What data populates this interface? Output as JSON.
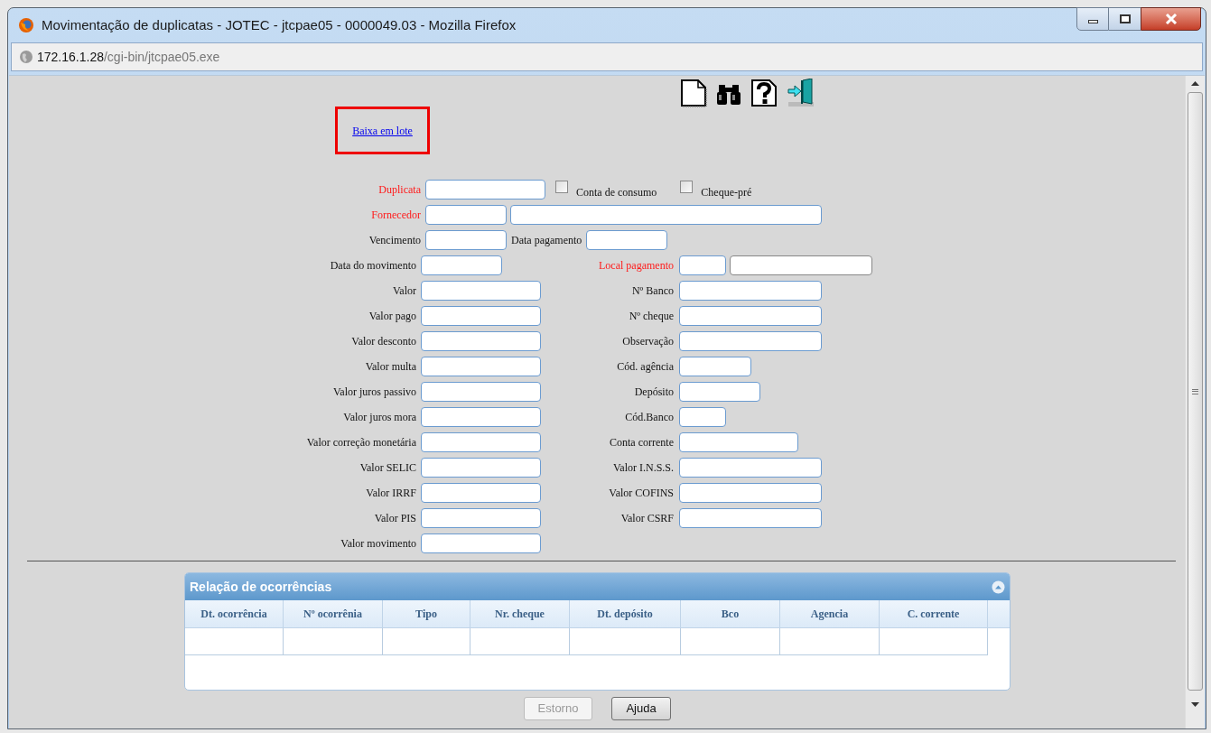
{
  "window": {
    "title": "Movimentação de duplicatas - JOTEC - jtcpae05 - 0000049.03 - Mozilla Firefox"
  },
  "address_bar": {
    "host": "172.16.1.28",
    "path": "/cgi-bin/jtcpae05.exe"
  },
  "link": {
    "text": "Baixa em lote",
    "highlighted": true
  },
  "form": {
    "duplicata": {
      "label": "Duplicata",
      "required": true
    },
    "checkboxes": [
      {
        "label": "Conta de consumo",
        "checked": false
      },
      {
        "label": "Cheque-pré",
        "checked": false
      }
    ],
    "fornecedor": {
      "label": "Fornecedor",
      "required": true
    },
    "vencimento": {
      "label": "Vencimento",
      "required": false
    },
    "data_pagamento": {
      "label": "Data pagamento",
      "required": false
    },
    "left_fields": [
      {
        "label": "Data do movimento",
        "required": false
      },
      {
        "label": "Valor",
        "required": false
      },
      {
        "label": "Valor pago",
        "required": false
      },
      {
        "label": "Valor desconto",
        "required": false
      },
      {
        "label": "Valor multa",
        "required": false
      },
      {
        "label": "Valor juros passivo",
        "required": false
      },
      {
        "label": "Valor juros mora",
        "required": false
      },
      {
        "label": "Valor correção monetária",
        "required": false
      },
      {
        "label": "Valor SELIC",
        "required": false
      },
      {
        "label": "Valor IRRF",
        "required": false
      },
      {
        "label": "Valor PIS",
        "required": false
      },
      {
        "label": "Valor movimento",
        "required": false
      }
    ],
    "right_fields": [
      {
        "label": "Local pagamento",
        "required": true
      },
      {
        "label": "Nº Banco",
        "required": false
      },
      {
        "label": "Nº cheque",
        "required": false
      },
      {
        "label": "Observação",
        "required": false
      },
      {
        "label": "Cód. agência",
        "required": false
      },
      {
        "label": "Depósito",
        "required": false
      },
      {
        "label": "Cód.Banco",
        "required": false
      },
      {
        "label": "Conta corrente",
        "required": false
      },
      {
        "label": "Valor I.N.S.S.",
        "required": false
      },
      {
        "label": "Valor COFINS",
        "required": false
      },
      {
        "label": "Valor CSRF",
        "required": false
      }
    ]
  },
  "occurrences": {
    "title": "Relação de ocorrências",
    "columns": [
      "Dt. ocorrência",
      "Nº ocorrênia",
      "Tipo",
      "Nr. cheque",
      "Dt. depósito",
      "Bco",
      "Agencia",
      "C. corrente"
    ]
  },
  "buttons": [
    {
      "label": "Estorno",
      "disabled": true
    },
    {
      "label": "Ajuda",
      "disabled": false
    }
  ]
}
